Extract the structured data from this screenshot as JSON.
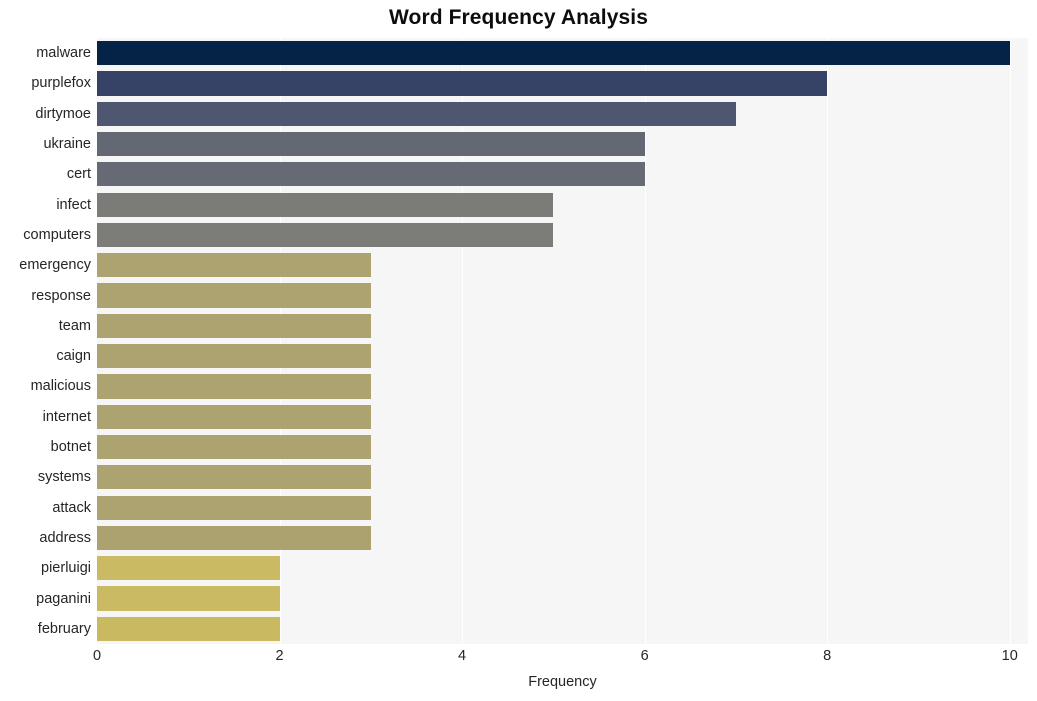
{
  "chart_data": {
    "type": "bar",
    "orientation": "horizontal",
    "title": "Word Frequency Analysis",
    "xlabel": "Frequency",
    "ylabel": "",
    "categories": [
      "malware",
      "purplefox",
      "dirtymoe",
      "ukraine",
      "cert",
      "infect",
      "computers",
      "emergency",
      "response",
      "team",
      "caign",
      "malicious",
      "internet",
      "botnet",
      "systems",
      "attack",
      "address",
      "pierluigi",
      "paganini",
      "february"
    ],
    "values": [
      10,
      8,
      7,
      6,
      6,
      5,
      5,
      3,
      3,
      3,
      3,
      3,
      3,
      3,
      3,
      3,
      3,
      2,
      2,
      2
    ],
    "bar_colors": [
      "#052247",
      "#374267",
      "#4f5670",
      "#646873",
      "#666a74",
      "#7b7b78",
      "#7c7c78",
      "#ada371",
      "#ada371",
      "#ada371",
      "#ada371",
      "#ada371",
      "#ada371",
      "#aca370",
      "#aca370",
      "#aca370",
      "#aba26f",
      "#c9ba63",
      "#c9ba63",
      "#c9ba62"
    ],
    "xlim": [
      0,
      10.2
    ],
    "xticks": [
      0,
      2,
      4,
      6,
      8,
      10
    ],
    "xtick_labels": [
      "0",
      "2",
      "4",
      "6",
      "8",
      "10"
    ],
    "grid": true,
    "grid_color": "#ffffff",
    "plot_background": "#f6f6f7",
    "figure_background": "#ffffff",
    "legend": null,
    "legend_position": "none"
  }
}
